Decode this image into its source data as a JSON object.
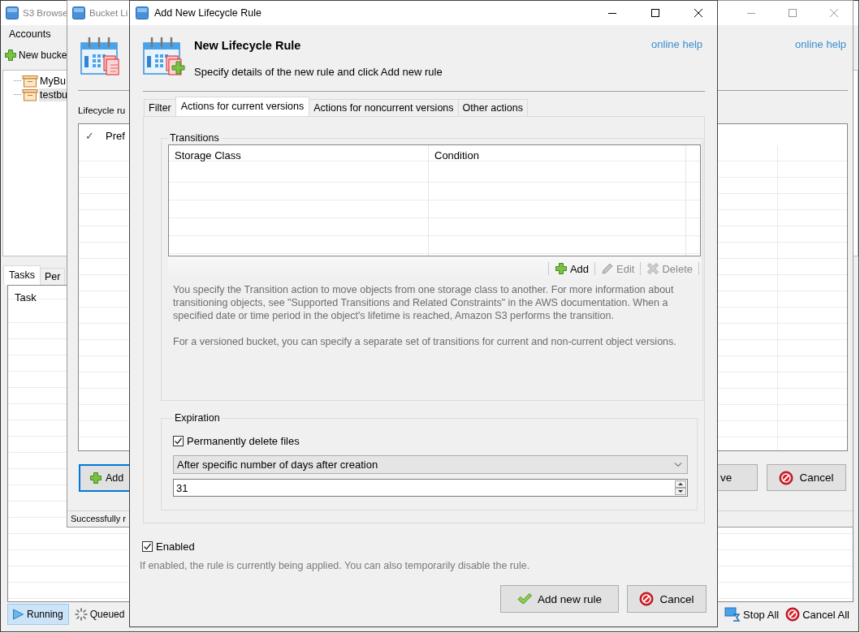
{
  "main_window": {
    "title": "S3 Browse",
    "menu": [
      "Accounts"
    ],
    "toolbar": [
      {
        "label": "New bucke"
      }
    ],
    "tree": [
      {
        "label": "MyBu",
        "selected": false
      },
      {
        "label": "testbu",
        "selected": true
      }
    ],
    "tabs": [
      {
        "label": "Tasks",
        "selected": true
      },
      {
        "label": "Per",
        "selected": false
      }
    ],
    "tasks_table": {
      "columns": [
        "Task"
      ]
    },
    "status_tabs": [
      {
        "label": "Running",
        "selected": true
      },
      {
        "label": "Queued",
        "selected": false
      }
    ],
    "actions": [
      {
        "label": "Stop All"
      },
      {
        "label": "Cancel All"
      }
    ]
  },
  "bucket_lifecycle_window": {
    "title": "Bucket Li",
    "online_help": "online help",
    "rules_label": "Lifecycle ru",
    "table": {
      "columns": [
        "✓",
        "Pref"
      ]
    },
    "buttons": [
      {
        "label": "Add",
        "focused": true
      },
      {
        "label": "ve",
        "focused": false
      },
      {
        "label": "Cancel",
        "focused": false
      }
    ],
    "status_bar": "Successfully r"
  },
  "dialog": {
    "title": "Add New Lifecycle Rule",
    "heading": "New Lifecycle Rule",
    "subheading": "Specify details of the new rule and click Add new rule",
    "online_help": "online help",
    "tabs": [
      {
        "label": "Filter",
        "selected": false
      },
      {
        "label": "Actions for current versions",
        "selected": true
      },
      {
        "label": "Actions for noncurrent versions",
        "selected": false
      },
      {
        "label": "Other actions",
        "selected": false
      }
    ],
    "transitions": {
      "title": "Transitions",
      "columns": [
        "Storage Class",
        "Condition"
      ],
      "toolbar": [
        {
          "label": "Add",
          "disabled": false
        },
        {
          "label": "Edit",
          "disabled": true
        },
        {
          "label": "Delete",
          "disabled": true
        }
      ],
      "description": [
        "You specify the Transition action to move objects from one storage class to another. For more information about transitioning objects, see \"Supported Transitions and Related Constraints\" in the AWS documentation. When a specified date or time period in the object's lifetime is reached, Amazon S3 performs the transition.",
        "For a versioned bucket, you can specify a separate set of transitions for current and non-current object versions."
      ]
    },
    "expiration": {
      "title": "Expiration",
      "permanently_delete": {
        "label": "Permanently delete files",
        "checked": true
      },
      "mode": {
        "value": "After specific number of days after creation"
      },
      "days": {
        "value": "31"
      }
    },
    "enabled": {
      "label": "Enabled",
      "checked": true
    },
    "enabled_hint": "If enabled, the rule is currently being applied. You can also temporarily disable the rule.",
    "buttons": [
      {
        "label": "Add new rule"
      },
      {
        "label": "Cancel"
      }
    ]
  }
}
